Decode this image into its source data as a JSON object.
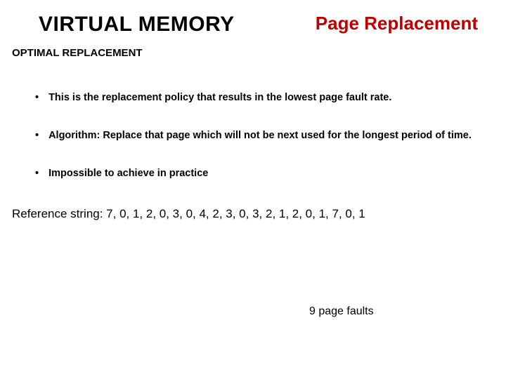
{
  "header": {
    "left_title": "VIRTUAL MEMORY",
    "right_title": "Page Replacement"
  },
  "subtitle": "OPTIMAL REPLACEMENT",
  "bullets": [
    "This is the replacement policy that results in the lowest page fault rate.",
    "Algorithm: Replace that page which will not be next used  for the longest period of time.",
    "Impossible to achieve in practice"
  ],
  "reference_string": "Reference string: 7, 0, 1, 2, 0, 3, 0, 4, 2, 3, 0, 3, 2, 1, 2, 0, 1, 7, 0, 1",
  "page_faults": "9 page faults"
}
